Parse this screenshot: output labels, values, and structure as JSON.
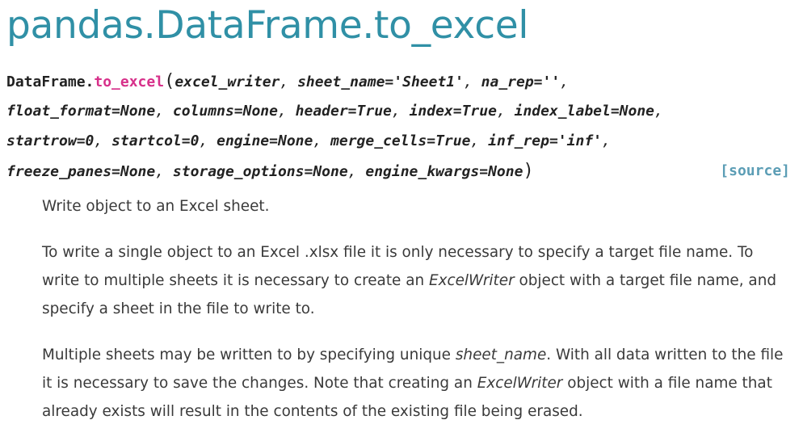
{
  "title": "pandas.DataFrame.to_excel",
  "signature": {
    "class_name": "DataFrame.",
    "function_name": "to_excel",
    "open_paren": "(",
    "close_paren": ")",
    "lines": [
      [
        "excel_writer",
        "sheet_name='Sheet1'",
        "na_rep=''"
      ],
      [
        "float_format=None",
        "columns=None",
        "header=True",
        "index=True",
        "index_label=None"
      ],
      [
        "startrow=0",
        "startcol=0",
        "engine=None",
        "merge_cells=True",
        "inf_rep='inf'"
      ],
      [
        "freeze_panes=None",
        "storage_options=None",
        "engine_kwargs=None"
      ]
    ],
    "source_link": "[source]"
  },
  "description": {
    "p1": "Write object to an Excel sheet.",
    "p2_a": "To write a single object to an Excel .xlsx file it is only necessary to specify a target file name. To write to multiple sheets it is necessary to create an ",
    "p2_em": "ExcelWriter",
    "p2_b": " object with a target file name, and specify a sheet in the file to write to.",
    "p3_a": "Multiple sheets may be written to by specifying unique ",
    "p3_em1": "sheet_name",
    "p3_b": ". With all data written to the file it is necessary to save the changes. Note that creating an ",
    "p3_em2": "ExcelWriter",
    "p3_c": " object with a file name that already exists will result in the contents of the existing file being erased."
  }
}
